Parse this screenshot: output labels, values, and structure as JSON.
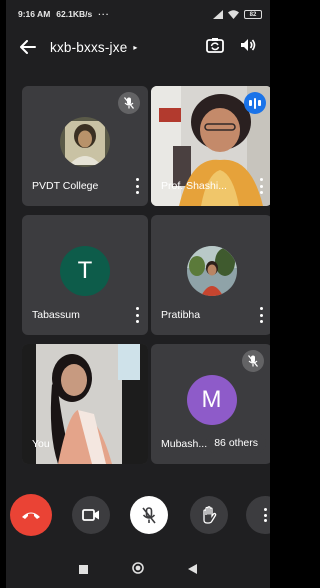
{
  "status_bar": {
    "time": "9:16 AM",
    "speed": "62.1KB/s",
    "extra": "···",
    "battery": "82"
  },
  "meeting": {
    "code": "kxb-bxxs-jxe",
    "caret": "▸"
  },
  "participants": [
    {
      "name": "PVDT College",
      "muted": true,
      "avatar": "photo"
    },
    {
      "name": "Prof. Shashi...",
      "speaking": true,
      "avatar": "video"
    },
    {
      "name": "Tabassum",
      "avatar_letter": "T",
      "avatar_color": "#0d5c4a"
    },
    {
      "name": "Pratibha",
      "avatar": "photo"
    },
    {
      "name": "You",
      "avatar": "video"
    },
    {
      "name": "Mubash...",
      "muted": true,
      "avatar_letter": "M",
      "avatar_color": "#8e5bc9"
    }
  ],
  "others_count_label": "86 others",
  "colors": {
    "end_call": "#ea4335",
    "speaking_badge": "#1a73e8",
    "tile_bg": "#3c3c3f",
    "background": "#1f1f21"
  }
}
